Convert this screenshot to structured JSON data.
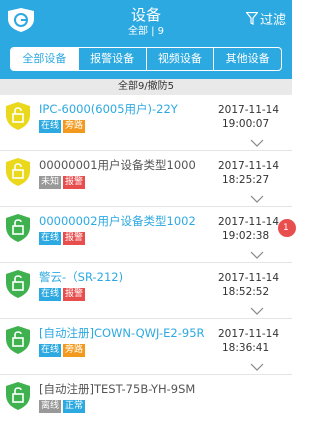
{
  "header": {
    "title": "设备",
    "subtitle": "全部 | 9",
    "filter_label": "过滤"
  },
  "tabs": [
    {
      "label": "全部设备",
      "active": true
    },
    {
      "label": "报警设备",
      "active": false
    },
    {
      "label": "视频设备",
      "active": false
    },
    {
      "label": "其他设备",
      "active": false
    }
  ],
  "summary": "全部9/撤防5",
  "devices": [
    {
      "name": "IPC-6000(6005用户)-22Y",
      "name_color": "blue",
      "status": "在线",
      "state": "旁路",
      "shield": "yellow",
      "date": "2017-11-14",
      "time": "19:00:07"
    },
    {
      "name": "00000001用户设备类型1000",
      "name_color": "gray",
      "status": "未知",
      "state": "报警",
      "shield": "yellow",
      "date": "2017-11-14",
      "time": "18:25:27"
    },
    {
      "name": "00000002用户设备类型1002",
      "name_color": "blue",
      "status": "在线",
      "state": "报警",
      "shield": "green",
      "date": "2017-11-14",
      "time": "19:02:38"
    },
    {
      "name": "警云-（SR-212)",
      "name_color": "blue",
      "status": "在线",
      "state": "报警",
      "shield": "green",
      "date": "2017-11-14",
      "time": "18:52:52"
    },
    {
      "name": "[自动注册]COWN-QWJ-E2-95R",
      "name_color": "blue",
      "status": "在线",
      "state": "旁路",
      "shield": "green",
      "date": "2017-11-14",
      "time": "18:36:41"
    },
    {
      "name": "[自动注册]TEST-75B-YH-9SM",
      "name_color": "gray",
      "status": "离线",
      "state": "正常",
      "shield": "green",
      "date": "",
      "time": ""
    }
  ],
  "notify_count": "1",
  "colors": {
    "accent": "#2ca9e1",
    "alarm": "#e94e4e",
    "bypass": "#f39a1e",
    "shield_green": "#3fb24f",
    "shield_yellow": "#e9d81b"
  }
}
